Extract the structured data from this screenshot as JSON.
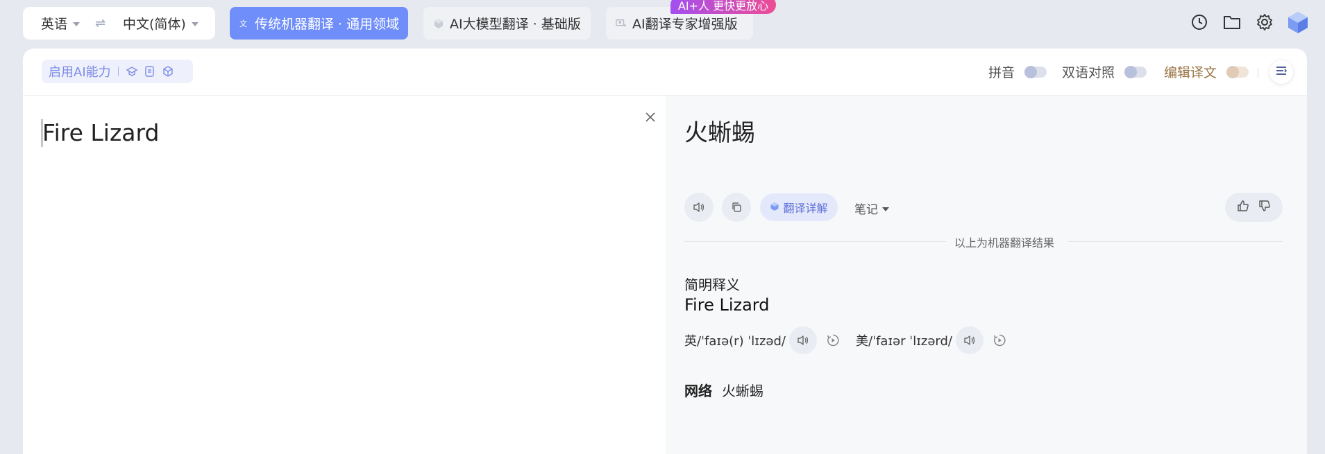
{
  "langbar": {
    "source": "英语",
    "target": "中文(简体)"
  },
  "modes": [
    {
      "label": "传统机器翻译 · 通用领域",
      "active": true
    },
    {
      "label": "AI大模型翻译 · 基础版",
      "active": false
    },
    {
      "label": "AI翻译专家增强版",
      "active": false
    }
  ],
  "ai_badge": "AI+人 更快更放心",
  "toolbar": {
    "ai_ability": "启用AI能力",
    "pinyin": "拼音",
    "bilingual": "双语对照",
    "edit_translation": "编辑译文"
  },
  "source_text": "Fire Lizard",
  "translation": "火蜥蜴",
  "actions": {
    "detail": "翻译详解",
    "notes": "笔记"
  },
  "machine_note": "以上为机器翻译结果",
  "brief": {
    "title": "简明释义",
    "word": "Fire Lizard",
    "uk_phonetic": "英/ˈfaɪə(r) ˈlɪzəd/",
    "us_phonetic": "美/ˈfaɪər ˈlɪzərd/",
    "network_label": "网络",
    "network_value": "火蜥蜴"
  },
  "colors": {
    "accent": "#6f8ef9",
    "badge_from": "#a24ff0",
    "badge_to": "#ee4d93",
    "edit": "#9a7344"
  }
}
